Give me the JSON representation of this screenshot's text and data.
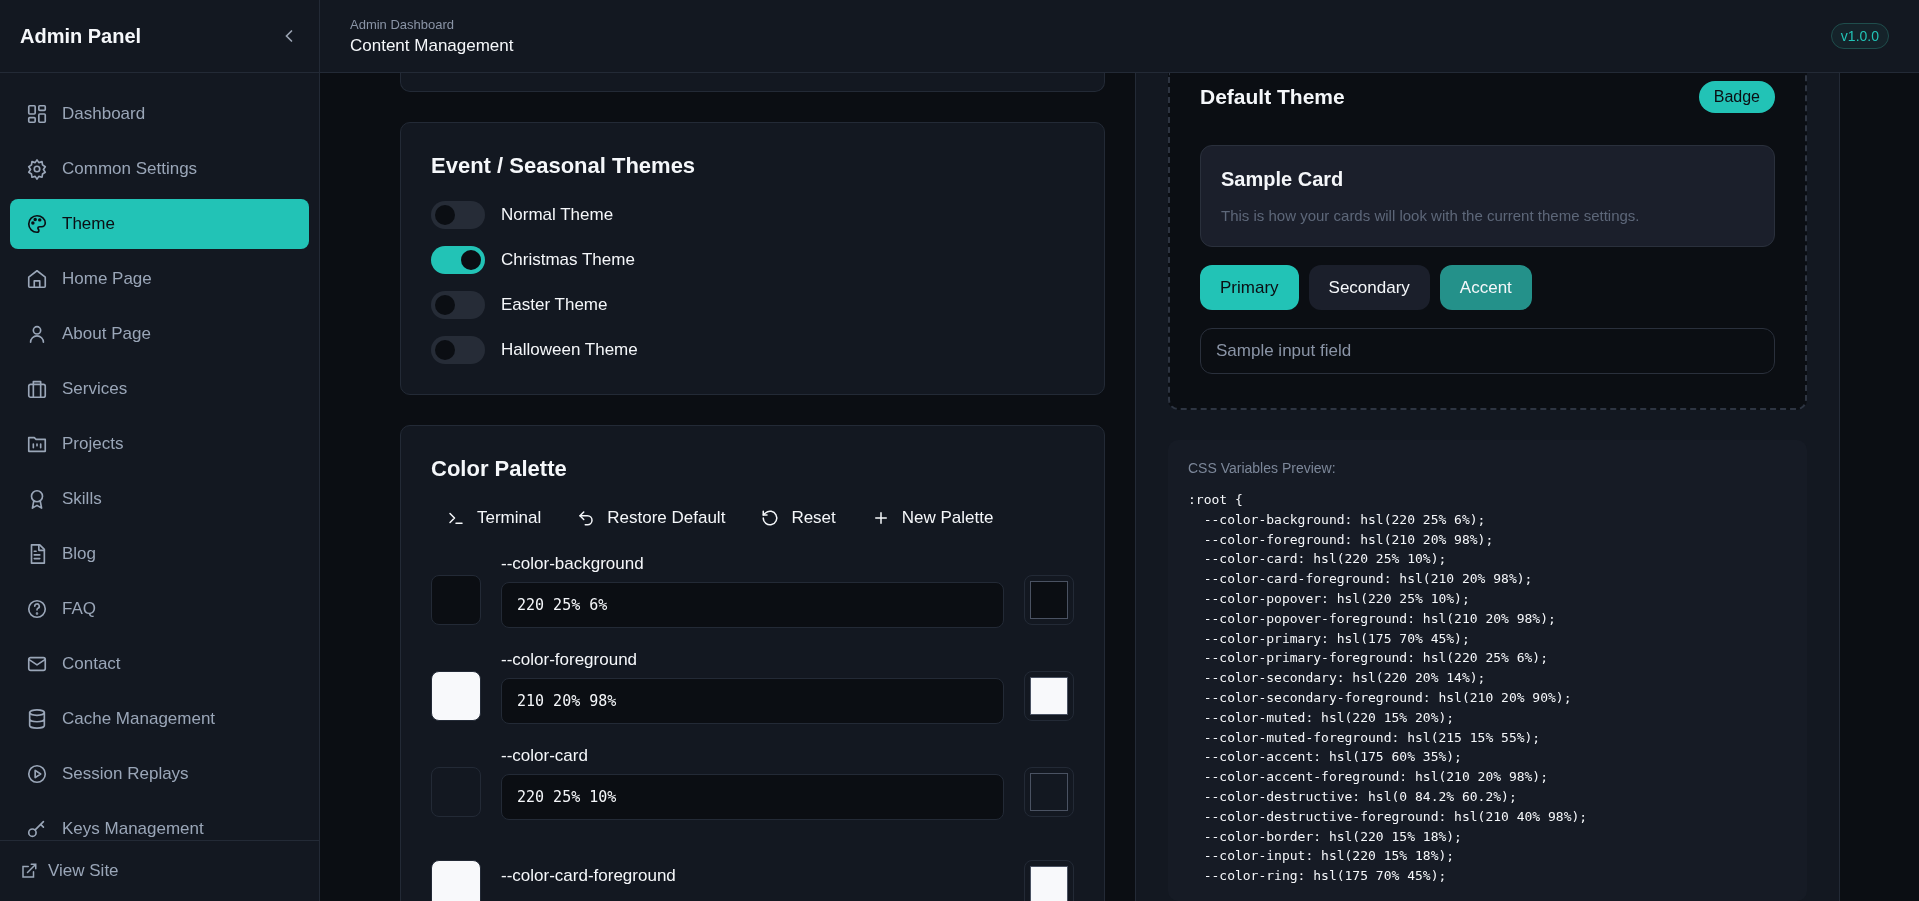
{
  "sidebar": {
    "title": "Admin Panel",
    "items": [
      {
        "label": "Dashboard",
        "selected": false
      },
      {
        "label": "Common Settings",
        "selected": false
      },
      {
        "label": "Theme",
        "selected": true
      },
      {
        "label": "Home Page",
        "selected": false
      },
      {
        "label": "About Page",
        "selected": false
      },
      {
        "label": "Services",
        "selected": false
      },
      {
        "label": "Projects",
        "selected": false
      },
      {
        "label": "Skills",
        "selected": false
      },
      {
        "label": "Blog",
        "selected": false
      },
      {
        "label": "FAQ",
        "selected": false
      },
      {
        "label": "Contact",
        "selected": false
      },
      {
        "label": "Cache Management",
        "selected": false
      },
      {
        "label": "Session Replays",
        "selected": false
      },
      {
        "label": "Keys Management",
        "selected": false
      }
    ],
    "footer_link": "View Site"
  },
  "header": {
    "breadcrumb": "Admin Dashboard",
    "title": "Content Management",
    "version": "v1.0.0"
  },
  "event_themes": {
    "title": "Event / Seasonal Themes",
    "themes": [
      {
        "label": "Normal Theme",
        "on": false
      },
      {
        "label": "Christmas Theme",
        "on": true
      },
      {
        "label": "Easter Theme",
        "on": false
      },
      {
        "label": "Halloween Theme",
        "on": false
      }
    ]
  },
  "color_palette": {
    "title": "Color Palette",
    "actions": [
      {
        "label": "Terminal"
      },
      {
        "label": "Restore Default"
      },
      {
        "label": "Reset"
      },
      {
        "label": "New Palette"
      }
    ],
    "colors": [
      {
        "name": "--color-background",
        "value": "220 25% 6%",
        "color": "#0b0e13"
      },
      {
        "name": "--color-foreground",
        "value": "210 20% 98%",
        "color": "#f8f9fb"
      },
      {
        "name": "--color-card",
        "value": "220 25% 10%",
        "color": "#131821"
      },
      {
        "name": "--color-card-foreground",
        "color": "#f8f9fb"
      }
    ]
  },
  "preview": {
    "title": "Default Theme",
    "badge": "Badge",
    "card_title": "Sample Card",
    "card_text": "This is how your cards will look with the current theme settings.",
    "buttons": [
      {
        "label": "Primary",
        "kind": "primary"
      },
      {
        "label": "Secondary",
        "kind": "secondary"
      },
      {
        "label": "Accent",
        "kind": "accent"
      }
    ],
    "input_placeholder": "Sample input field"
  },
  "css_preview": {
    "label": "CSS Variables Preview:",
    "lines": [
      ":root {",
      "  --color-background: hsl(220 25% 6%);",
      "  --color-foreground: hsl(210 20% 98%);",
      "  --color-card: hsl(220 25% 10%);",
      "  --color-card-foreground: hsl(210 20% 98%);",
      "  --color-popover: hsl(220 25% 10%);",
      "  --color-popover-foreground: hsl(210 20% 98%);",
      "  --color-primary: hsl(175 70% 45%);",
      "  --color-primary-foreground: hsl(220 25% 6%);",
      "  --color-secondary: hsl(220 20% 14%);",
      "  --color-secondary-foreground: hsl(210 20% 90%);",
      "  --color-muted: hsl(220 15% 20%);",
      "  --color-muted-foreground: hsl(215 15% 55%);",
      "  --color-accent: hsl(175 60% 35%);",
      "  --color-accent-foreground: hsl(210 20% 98%);",
      "  --color-destructive: hsl(0 84.2% 60.2%);",
      "  --color-destructive-foreground: hsl(210 40% 98%);",
      "  --color-border: hsl(220 15% 18%);",
      "  --color-input: hsl(220 15% 18%);",
      "  --color-ring: hsl(175 70% 45%);"
    ]
  }
}
